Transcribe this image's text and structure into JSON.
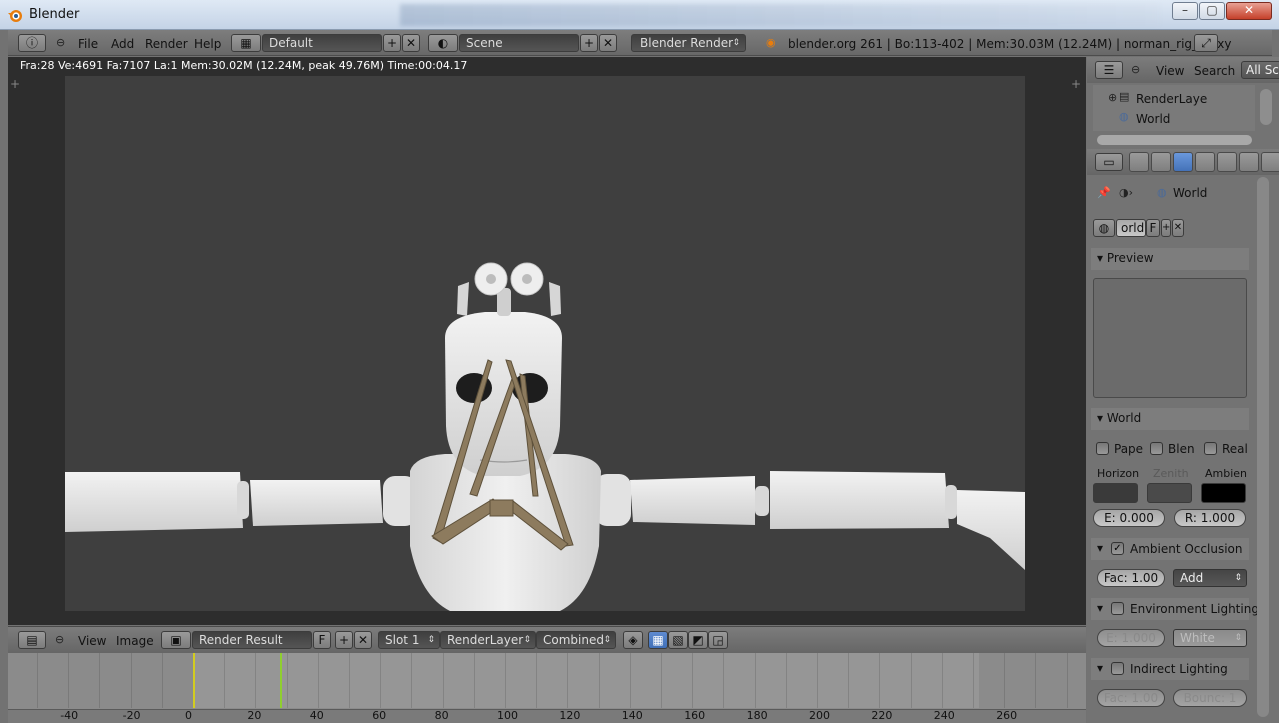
{
  "window": {
    "title": "Blender",
    "min": "–",
    "max": "▢",
    "close": "✕"
  },
  "menu": {
    "file": "File",
    "add": "Add",
    "render": "Render",
    "help": "Help"
  },
  "header": {
    "screen_layout": "Default",
    "scene": "Scene",
    "engine": "Blender Render",
    "info": "blender.org 261 | Bo:113-402 | Mem:30.03M (12.24M) | norman_rig_proxy"
  },
  "viewer": {
    "status": "Fra:28  Ve:4691 Fa:7107 La:1 Mem:30.02M (12.24M, peak 49.76M) Time:00:04.17"
  },
  "image_toolbar": {
    "view": "View",
    "image": "Image",
    "image_name": "Render Result",
    "fake_user": "F",
    "slot": "Slot 1",
    "layer": "RenderLayer",
    "pass": "Combined"
  },
  "timeline": {
    "current_frame": 28,
    "start_frame": 0,
    "ticks": [
      "-40",
      "-20",
      "0",
      "20",
      "40",
      "60",
      "80",
      "100",
      "120",
      "140",
      "160",
      "180",
      "200",
      "220",
      "240",
      "260"
    ]
  },
  "outliner": {
    "view": "View",
    "search": "Search",
    "filter": "All Sc",
    "items": [
      "RenderLaye",
      "World"
    ]
  },
  "properties": {
    "breadcrumb": "World",
    "datablock_name": "orld",
    "datablock_fake": "F",
    "preview_title": "Preview",
    "world_title": "World",
    "checks": [
      "Pape",
      "Blen",
      "Real"
    ],
    "colors": {
      "horizon_label": "Horizon",
      "zenith_label": "Zenith",
      "ambient_label": "Ambien",
      "horizon": "#3a3a3a",
      "zenith": "#4a4a4a",
      "ambient": "#000000"
    },
    "exposure": "E: 0.000",
    "range": "R: 1.000",
    "ao": {
      "title": "Ambient Occlusion",
      "enabled": true,
      "factor": "Fac: 1.00",
      "blend": "Add"
    },
    "env": {
      "title": "Environment Lighting",
      "enabled": false,
      "energy": "E: 1.000",
      "color": "White"
    },
    "indirect": {
      "title": "Indirect Lighting",
      "enabled": false,
      "factor": "Fac: 1.00",
      "bounces": "Bounc: 1"
    }
  }
}
